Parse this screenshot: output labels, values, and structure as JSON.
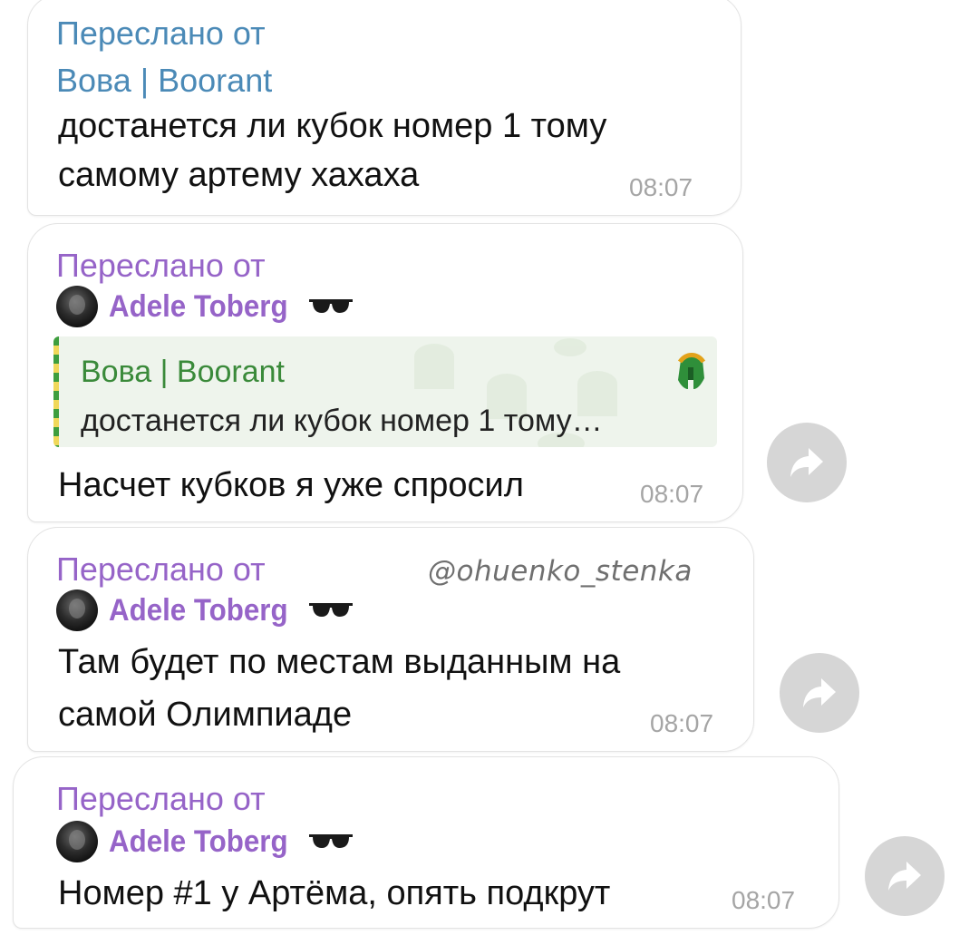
{
  "colors": {
    "forward_blue": "#4b8ab7",
    "forward_purple": "#9664c8",
    "reply_green": "#3a8a3a",
    "time_gray": "#a5a5a5",
    "share_bg": "#d6d6d6"
  },
  "watermark": "@ohuenko_stenka",
  "messages": [
    {
      "forward_label": "Переслано от",
      "forward_from": "Вова | Boorant",
      "text_lines": [
        "достанется ли кубок номер 1 тому",
        "самому артему хахаха"
      ],
      "time": "08:07"
    },
    {
      "forward_label": "Переслано от",
      "sender": "Adele Toberg",
      "sender_icon": "sunglasses-icon",
      "reply": {
        "name": "Вова | Boorant",
        "text": "достанется ли кубок номер 1 тому…",
        "icon": "spartan-helmet-icon"
      },
      "text": "Насчет кубков я уже спросил",
      "time": "08:07",
      "share_icon": "share-arrow-icon"
    },
    {
      "forward_label": "Переслано от",
      "sender": "Adele Toberg",
      "sender_icon": "sunglasses-icon",
      "text_lines": [
        "Там будет по местам выданным на",
        "самой Олимпиаде"
      ],
      "time": "08:07",
      "share_icon": "share-arrow-icon"
    },
    {
      "forward_label": "Переслано от",
      "sender": "Adele Toberg",
      "sender_icon": "sunglasses-icon",
      "text": "Номер #1 у Артёма, опять подкрут",
      "time": "08:07",
      "share_icon": "share-arrow-icon"
    }
  ]
}
